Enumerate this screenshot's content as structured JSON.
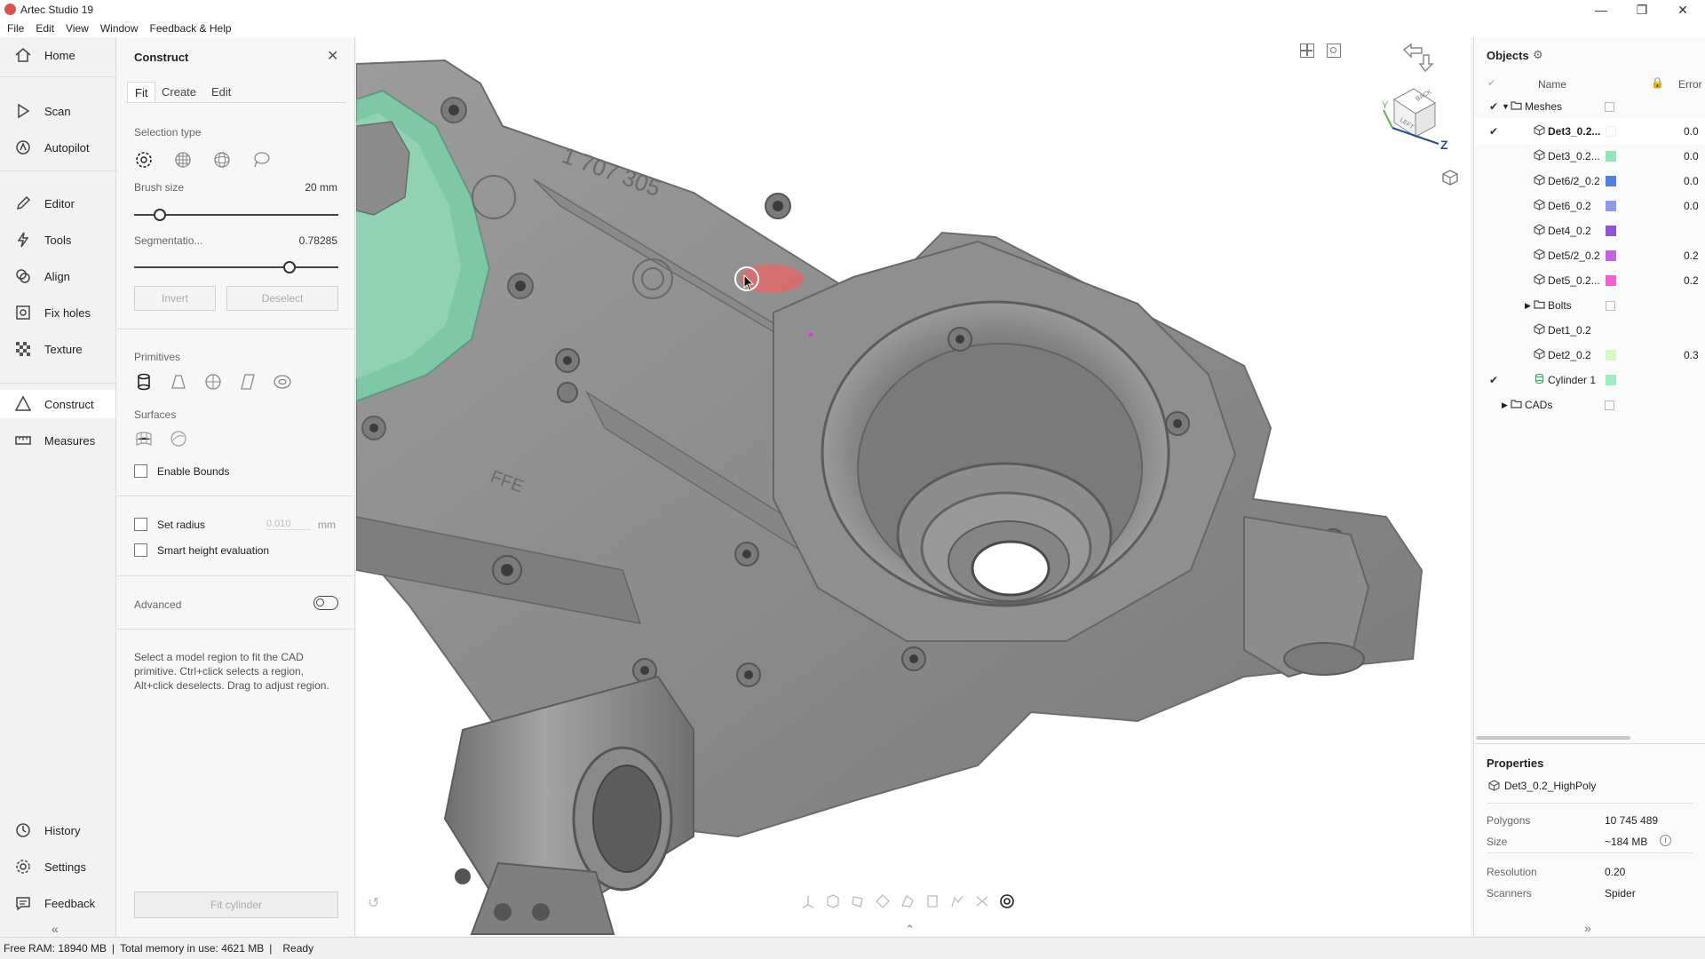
{
  "app": {
    "title": "Artec Studio 19"
  },
  "menu": [
    "File",
    "Edit",
    "View",
    "Window",
    "Feedback & Help"
  ],
  "nav": {
    "items": [
      {
        "label": "Home",
        "icon": "home-icon"
      },
      {
        "label": "Scan",
        "icon": "play-icon"
      },
      {
        "label": "Autopilot",
        "icon": "autopilot-icon"
      },
      {
        "label": "Editor",
        "icon": "pencil-icon"
      },
      {
        "label": "Tools",
        "icon": "lightning-icon"
      },
      {
        "label": "Align",
        "icon": "align-icon"
      },
      {
        "label": "Fix holes",
        "icon": "fix-holes-icon"
      },
      {
        "label": "Texture",
        "icon": "texture-icon"
      },
      {
        "label": "Construct",
        "icon": "construct-icon"
      },
      {
        "label": "Measures",
        "icon": "ruler-icon"
      }
    ],
    "bottom": [
      {
        "label": "History",
        "icon": "history-icon"
      },
      {
        "label": "Settings",
        "icon": "gear-icon"
      },
      {
        "label": "Feedback",
        "icon": "feedback-icon"
      }
    ],
    "collapse": "«"
  },
  "construct": {
    "title": "Construct",
    "tabs": [
      "Fit",
      "Create",
      "Edit"
    ],
    "selection_type_label": "Selection type",
    "brush_size_label": "Brush size",
    "brush_size_value": "20 mm",
    "brush_size_level": 0.1,
    "segmentation_label": "Segmentatio...",
    "segmentation_value": "0.78285",
    "segmentation_level": 0.78,
    "invert_label": "Invert",
    "deselect_label": "Deselect",
    "primitives_label": "Primitives",
    "surfaces_label": "Surfaces",
    "enable_bounds_label": "Enable Bounds",
    "set_radius_label": "Set radius",
    "set_radius_value": "0.010",
    "set_radius_unit": "mm",
    "smart_height_label": "Smart height evaluation",
    "advanced_label": "Advanced",
    "help_text": "Select a model region to fit the CAD primitive. Ctrl+click selects a region, Alt+click deselects. Drag to adjust region.",
    "fit_button": "Fit cylinder"
  },
  "viewport": {
    "axis_y": "Y",
    "axis_z": "Z",
    "cube_back": "BACK",
    "cube_left": "LEFT",
    "part_text_1": "1 707 305",
    "part_text_2": "FFE"
  },
  "objects": {
    "title": "Objects",
    "col_name": "Name",
    "col_error": "Error",
    "rows": [
      {
        "name": "Meshes",
        "kind": "folder",
        "indent": 0,
        "check": "✔",
        "color": "",
        "error": ""
      },
      {
        "name": "Det3_0.2...",
        "kind": "mesh",
        "indent": 1,
        "check": "✔",
        "color": "#ffffff",
        "error": "0.0",
        "bold": true
      },
      {
        "name": "Det3_0.2...",
        "kind": "mesh",
        "indent": 1,
        "check": "",
        "color": "#8fe6b8",
        "error": "0.0"
      },
      {
        "name": "Det6/2_0.2",
        "kind": "mesh",
        "indent": 1,
        "check": "",
        "color": "#4f82e0",
        "error": "0.0"
      },
      {
        "name": "Det6_0.2",
        "kind": "mesh",
        "indent": 1,
        "check": "",
        "color": "#8f9be6",
        "error": "0.0"
      },
      {
        "name": "Det4_0.2",
        "kind": "mesh",
        "indent": 1,
        "check": "",
        "color": "#8b55d6",
        "error": ""
      },
      {
        "name": "Det5/2_0.2",
        "kind": "mesh",
        "indent": 1,
        "check": "",
        "color": "#c065e0",
        "error": "0.2"
      },
      {
        "name": "Det5_0.2...",
        "kind": "mesh",
        "indent": 1,
        "check": "",
        "color": "#f060d0",
        "error": "0.2"
      },
      {
        "name": "Bolts",
        "kind": "folder",
        "indent": 1,
        "check": "",
        "color": "",
        "error": ""
      },
      {
        "name": "Det1_0.2",
        "kind": "mesh",
        "indent": 1,
        "check": "",
        "color": "",
        "error": ""
      },
      {
        "name": "Det2_0.2",
        "kind": "mesh",
        "indent": 1,
        "check": "",
        "color": "#d6f5c8",
        "error": "0.3"
      },
      {
        "name": "Cylinder 1",
        "kind": "cylinder",
        "indent": 1,
        "check": "✔",
        "color": "#9eeec2",
        "error": ""
      },
      {
        "name": "CADs",
        "kind": "folder",
        "indent": 0,
        "check": "",
        "color": "",
        "error": ""
      }
    ]
  },
  "properties": {
    "title": "Properties",
    "object_name": "Det3_0.2_HighPoly",
    "polygons_label": "Polygons",
    "polygons_value": "10 745 489",
    "size_label": "Size",
    "size_value": "~184 MB",
    "resolution_label": "Resolution",
    "resolution_value": "0.20",
    "scanners_label": "Scanners",
    "scanners_value": "Spider"
  },
  "status": {
    "free_ram": "Free RAM: 18940 MB",
    "total_memory": "Total memory in use: 4621 MB",
    "state": "Ready"
  }
}
